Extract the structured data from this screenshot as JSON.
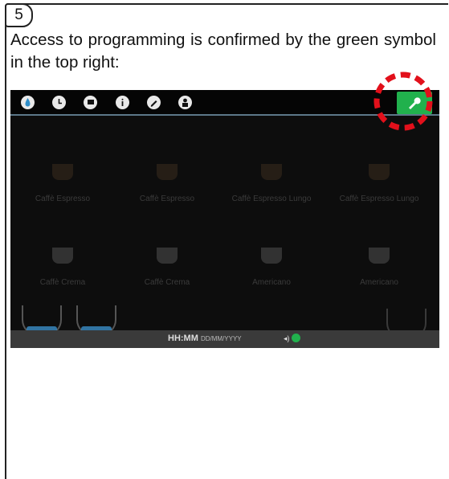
{
  "step": {
    "number": "5"
  },
  "instruction": "Access to programming is confirmed by the green symbol in the top right:",
  "screen": {
    "top_icons": [
      "water-drop-icon",
      "clock-icon",
      "flag-icon",
      "info-icon",
      "pencil-icon",
      "user-icon"
    ],
    "programming_icon": "wrench-icon",
    "products": [
      {
        "label": "Caffè Espresso"
      },
      {
        "label": "Caffè Espresso"
      },
      {
        "label": "Caffè Espresso Lungo"
      },
      {
        "label": "Caffè Espresso Lungo"
      },
      {
        "label": "Caffè Crema"
      },
      {
        "label": "Caffè Crema"
      },
      {
        "label": "Americano"
      },
      {
        "label": "Americano"
      }
    ],
    "status": {
      "time": "HH:MM",
      "date": "DD/MM/YYYY"
    }
  },
  "colors": {
    "confirm_green": "#21b14d",
    "highlight_red": "#e2101b"
  }
}
